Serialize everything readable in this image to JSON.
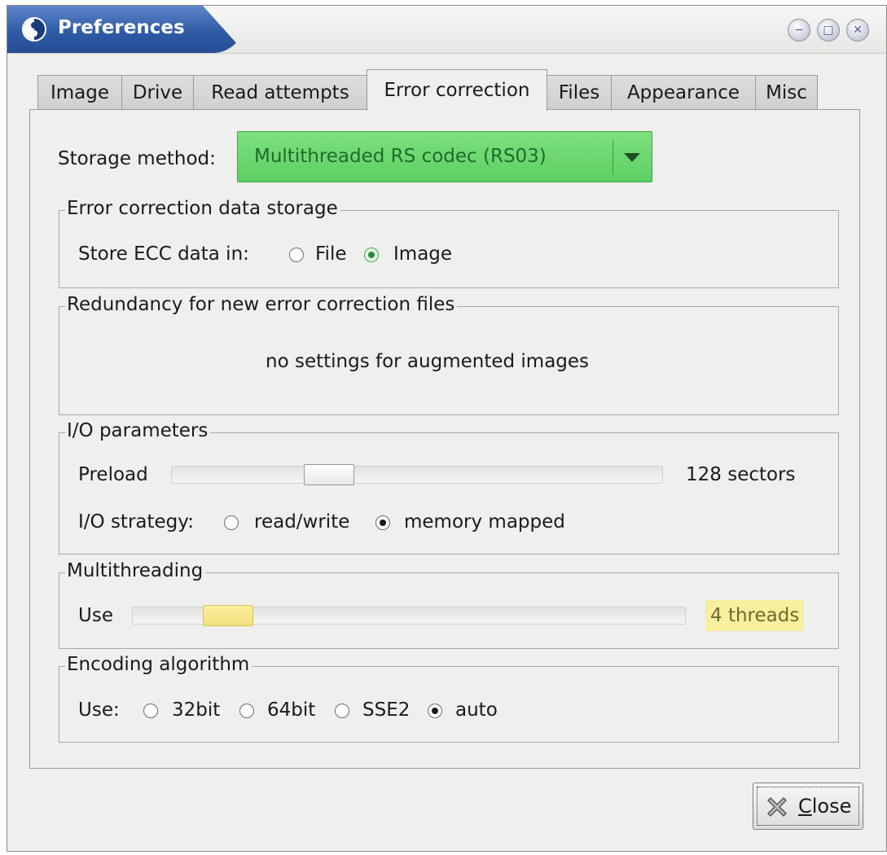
{
  "window": {
    "title": "Preferences",
    "controls": {
      "minimize": "−",
      "maximize": "□",
      "close": "✕"
    }
  },
  "tabs": [
    {
      "label": "Image",
      "active": false
    },
    {
      "label": "Drive",
      "active": false
    },
    {
      "label": "Read attempts",
      "active": false
    },
    {
      "label": "Error correction",
      "active": true
    },
    {
      "label": "Files",
      "active": false
    },
    {
      "label": "Appearance",
      "active": false
    },
    {
      "label": "Misc",
      "active": false
    }
  ],
  "storage_method": {
    "label": "Storage method:",
    "selected": "Multithreaded RS codec (RS03)",
    "accent_color": "#5ccf63"
  },
  "ecc_storage": {
    "frame_title": "Error correction data storage",
    "label": "Store ECC data in:",
    "options": [
      {
        "label": "File",
        "checked": false
      },
      {
        "label": "Image",
        "checked": true
      }
    ]
  },
  "redundancy": {
    "frame_title": "Redundancy for new error correction files",
    "message": "no settings for augmented images"
  },
  "io_parameters": {
    "frame_title": "I/O parameters",
    "preload_label": "Preload",
    "preload_value": "128 sectors",
    "preload_fraction": 0.3,
    "strategy_label": "I/O strategy:",
    "strategy_options": [
      {
        "label": "read/write",
        "checked": false
      },
      {
        "label": "memory mapped",
        "checked": true
      }
    ]
  },
  "multithreading": {
    "frame_title": "Multithreading",
    "use_label": "Use",
    "value": "4 threads",
    "fraction": 0.14,
    "highlight_color": "#f7ef9e"
  },
  "encoding": {
    "frame_title": "Encoding algorithm",
    "use_label": "Use:",
    "options": [
      {
        "label": "32bit",
        "checked": false
      },
      {
        "label": "64bit",
        "checked": false
      },
      {
        "label": "SSE2",
        "checked": false
      },
      {
        "label": "auto",
        "checked": true
      }
    ]
  },
  "close_button": {
    "mnemonic": "C",
    "rest": "lose"
  }
}
